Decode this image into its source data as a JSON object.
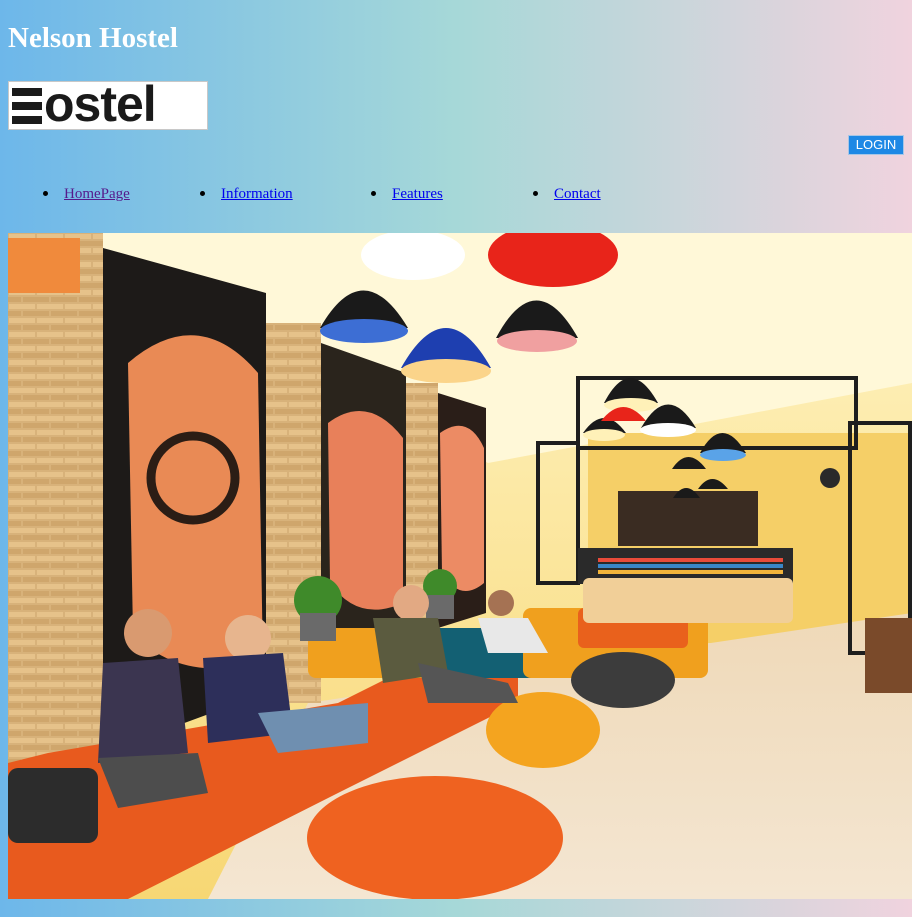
{
  "header": {
    "site_title": "Nelson Hostel",
    "logo_text": "ostel",
    "logo_full": "Hostel"
  },
  "auth": {
    "login_label": "LOGIN"
  },
  "nav": {
    "items": [
      {
        "label": "HomePage"
      },
      {
        "label": "Information"
      },
      {
        "label": "Features"
      },
      {
        "label": "Contact"
      }
    ]
  },
  "hero": {
    "description": ""
  },
  "colors": {
    "accent": "#1e88e5",
    "gradient_left": "#6db7ea",
    "gradient_right": "#f0d3de"
  }
}
